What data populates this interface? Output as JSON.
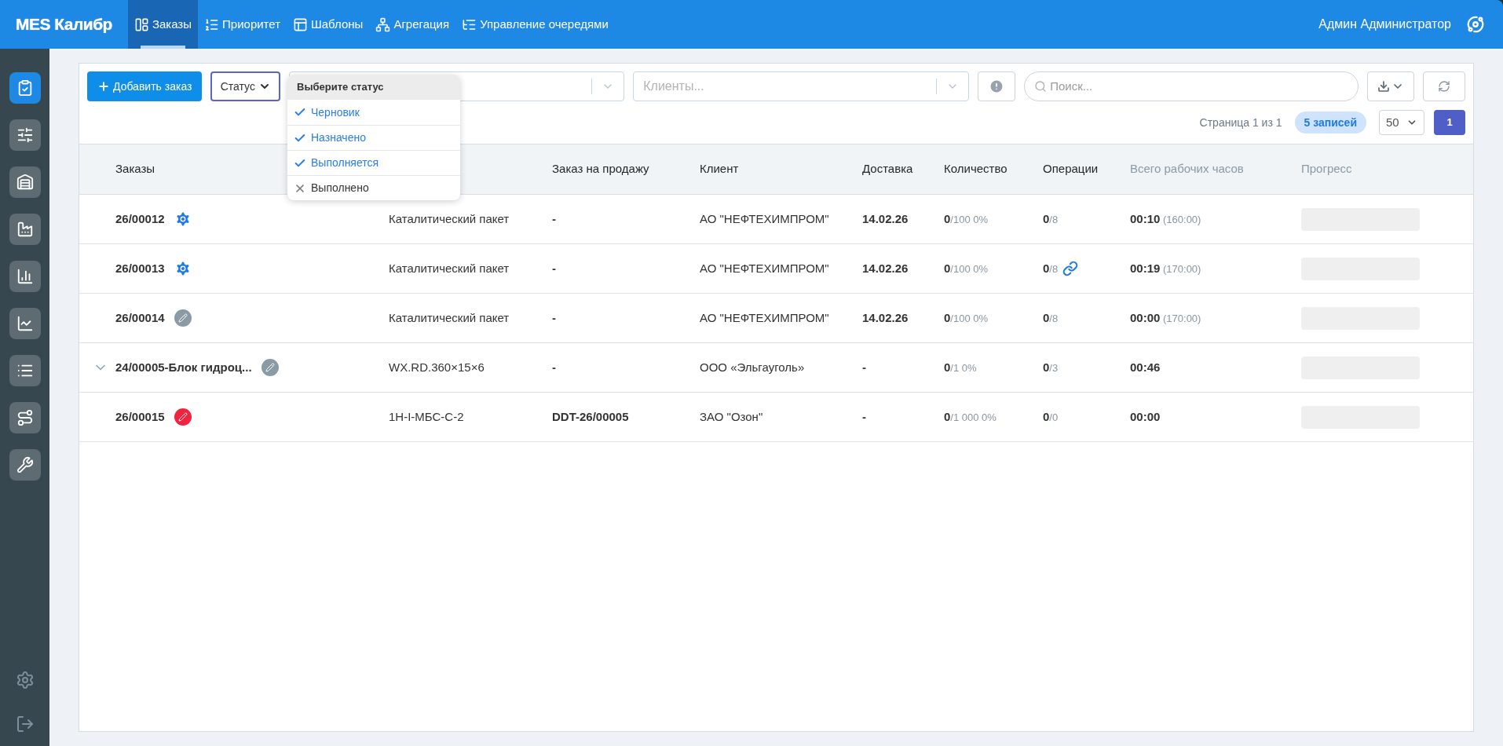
{
  "app_title": "MES Калибр",
  "nav": [
    {
      "label": "Заказы",
      "kind": "board",
      "selected": true
    },
    {
      "label": "Приоритет",
      "kind": "priority",
      "selected": false
    },
    {
      "label": "Шаблоны",
      "kind": "templates",
      "selected": false
    },
    {
      "label": "Агрегация",
      "kind": "aggregation",
      "selected": false
    },
    {
      "label": "Управление очередями",
      "kind": "queues",
      "selected": false
    }
  ],
  "user_name": "Админ Администратор",
  "sidebar": {
    "items": [
      {
        "kind": "orders",
        "selected": true
      },
      {
        "kind": "filters",
        "selected": false
      },
      {
        "kind": "storage",
        "selected": false
      },
      {
        "kind": "factory",
        "selected": false
      },
      {
        "kind": "report",
        "selected": false
      },
      {
        "kind": "chart",
        "selected": false
      },
      {
        "kind": "list",
        "selected": false
      },
      {
        "kind": "route",
        "selected": false
      },
      {
        "kind": "tools",
        "selected": false
      }
    ]
  },
  "toolbar": {
    "add_button": "Добавить заказ",
    "status_button": "Статус",
    "clients_placeholder": "Клиенты...",
    "search_placeholder": "Поиск..."
  },
  "status_dropdown": {
    "title": "Выберите статус",
    "options": [
      {
        "label": "Черновик",
        "checked": true
      },
      {
        "label": "Назначено",
        "checked": true
      },
      {
        "label": "Выполняется",
        "checked": true
      },
      {
        "label": "Выполнено",
        "checked": false
      }
    ]
  },
  "pagination": {
    "page_info": "Страница 1 из 1",
    "records": "5 записей",
    "page_size": "50",
    "current_page": "1"
  },
  "table": {
    "columns": [
      {
        "label": "Заказы",
        "muted": false
      },
      {
        "label": "Заказ на продажу",
        "muted": false
      },
      {
        "label": "Клиент",
        "muted": false
      },
      {
        "label": "Доставка",
        "muted": false
      },
      {
        "label": "Количество",
        "muted": false
      },
      {
        "label": "Операции",
        "muted": false
      },
      {
        "label": "Всего рабочих часов",
        "muted": true
      },
      {
        "label": "Прогресс",
        "muted": true
      }
    ],
    "rows": [
      {
        "expandable": false,
        "order": "26/00012",
        "kind": "gear",
        "product": "Каталитический пакет",
        "sale_order": "-",
        "client": "АО \"НЕФТЕХИМПРОМ\"",
        "delivery": "14.02.26",
        "qty_done": "0",
        "qty_rest": "/100 0%",
        "ops_done": "0",
        "ops_total": "/8",
        "linked": false,
        "hours": "00:10",
        "hours_plan": "(160:00)",
        "level": 0
      },
      {
        "expandable": false,
        "order": "26/00013",
        "kind": "gear",
        "product": "Каталитический пакет",
        "sale_order": "-",
        "client": "АО \"НЕФТЕХИМПРОМ\"",
        "delivery": "14.02.26",
        "qty_done": "0",
        "qty_rest": "/100 0%",
        "ops_done": "0",
        "ops_total": "/8",
        "linked": true,
        "hours": "00:19",
        "hours_plan": "(170:00)",
        "level": 0
      },
      {
        "expandable": false,
        "order": "26/00014",
        "kind": "pencil",
        "product": "Каталитический пакет",
        "sale_order": "-",
        "client": "АО \"НЕФТЕХИМПРОМ\"",
        "delivery": "14.02.26",
        "qty_done": "0",
        "qty_rest": "/100 0%",
        "ops_done": "0",
        "ops_total": "/8",
        "linked": false,
        "hours": "00:00",
        "hours_plan": "(170:00)",
        "level": 0
      },
      {
        "expandable": true,
        "order": "24/00005-Блок гидроц...",
        "kind": "pencil",
        "product": "WX.RD.360×15×6",
        "sale_order": "-",
        "client": "ООО «Эльгауголь»",
        "delivery": "-",
        "qty_done": "0",
        "qty_rest": "/1 0%",
        "ops_done": "0",
        "ops_total": "/3",
        "linked": false,
        "hours": "00:46",
        "level": 0
      },
      {
        "expandable": false,
        "order": "26/00015",
        "kind": "pencil-alert",
        "product": "1H-I-МБС-С-2",
        "sale_order": "DDT-26/00005",
        "client": "ЗАО \"Озон\"",
        "delivery": "-",
        "qty_done": "0",
        "qty_rest": "/1 000 0%",
        "ops_done": "0",
        "ops_total": "/0",
        "linked": false,
        "hours": "00:00",
        "level": 0
      }
    ]
  }
}
